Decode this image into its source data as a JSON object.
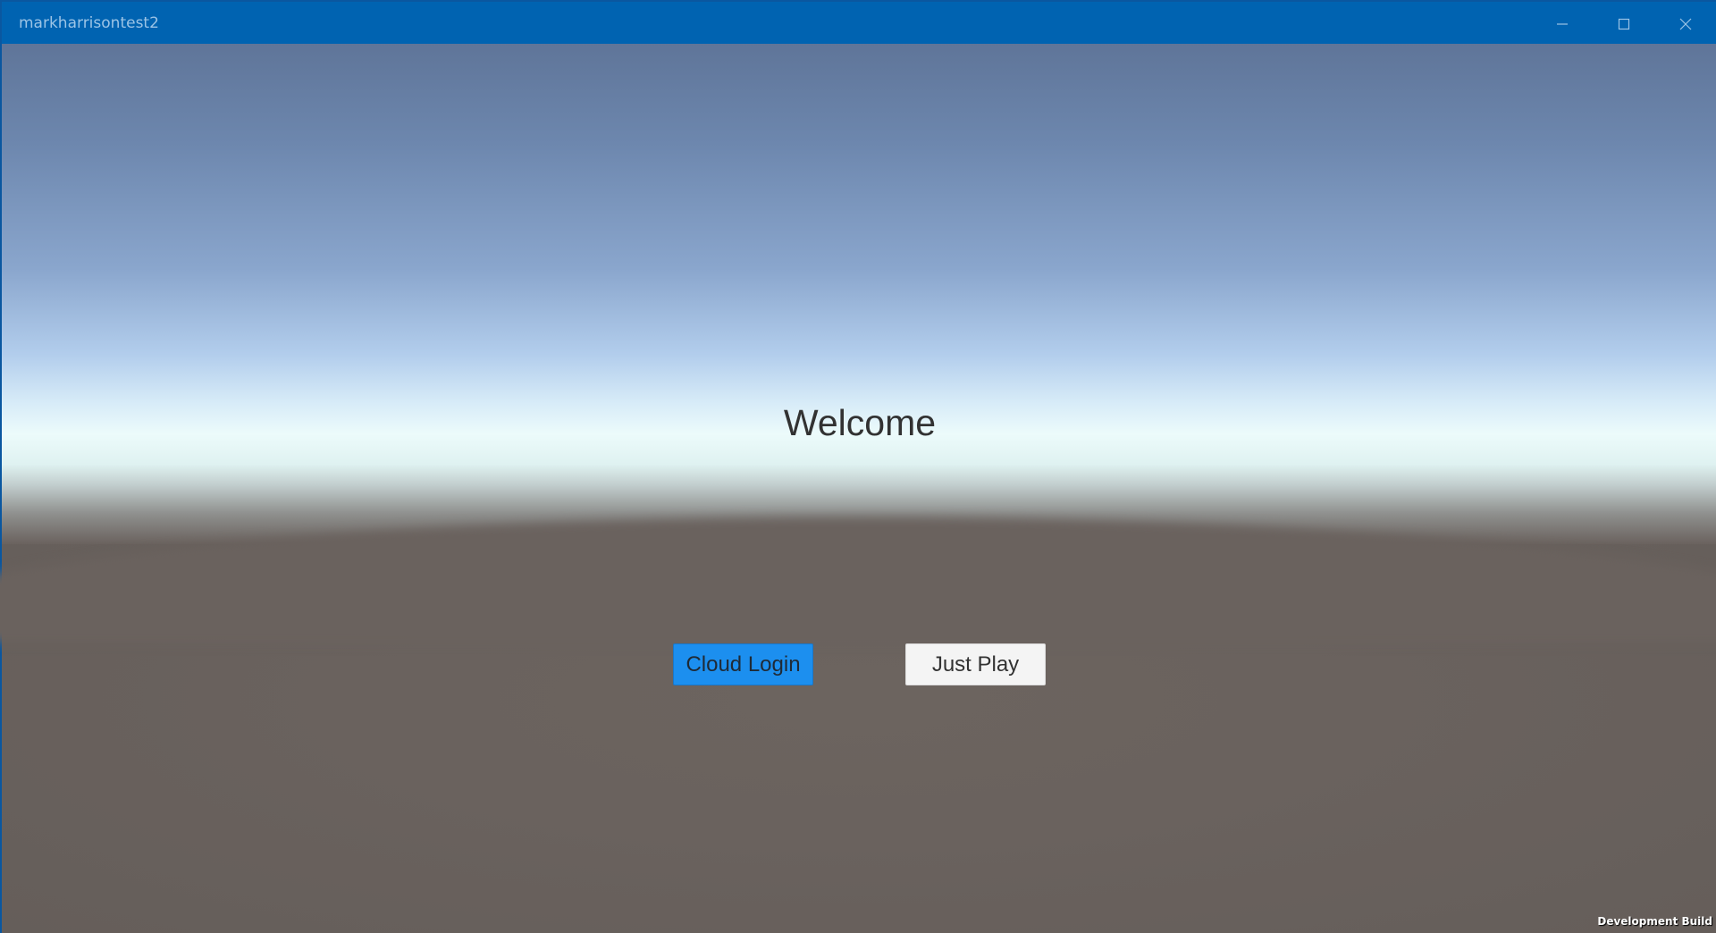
{
  "window": {
    "title": "markharrisontest2",
    "titlebar_color": "#0063b1",
    "controls": {
      "minimize_icon": "minimize-icon",
      "maximize_icon": "maximize-icon",
      "close_icon": "close-icon"
    }
  },
  "scene": {
    "welcome_text": "Welcome",
    "sky_color": "#6d87ae",
    "ground_color": "#6a625e"
  },
  "buttons": {
    "cloud_login": {
      "label": "Cloud Login",
      "color": "#1c8fef"
    },
    "just_play": {
      "label": "Just Play",
      "color": "#f4f4f4"
    }
  },
  "watermark": {
    "text": "Development Build"
  }
}
